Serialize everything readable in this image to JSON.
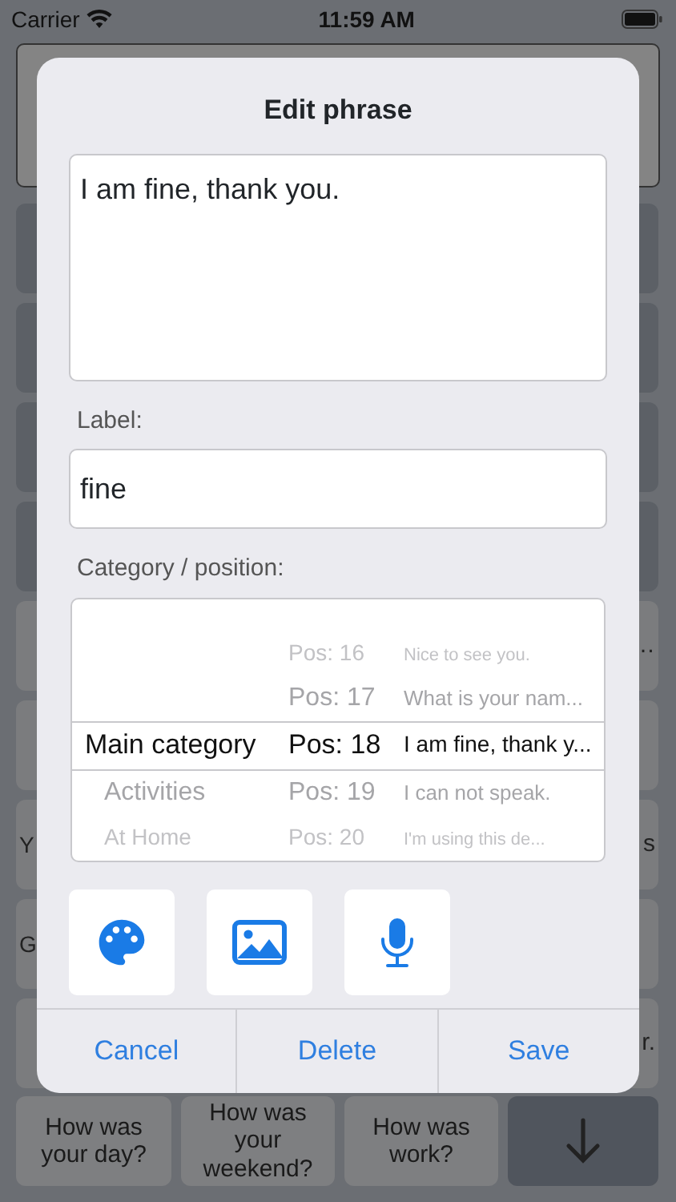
{
  "status_bar": {
    "carrier": "Carrier",
    "time": "11:59 AM"
  },
  "tile_rows": [
    {
      "dark": true
    },
    {
      "dark": true
    },
    {
      "dark": true
    },
    {
      "dark": true
    },
    {
      "dark": false,
      "right": "…"
    },
    {
      "dark": false
    },
    {
      "dark": false,
      "left": "Y",
      "right": "s"
    },
    {
      "dark": false,
      "left": "G"
    },
    {
      "dark": false,
      "right": "r."
    }
  ],
  "quick_phrases": [
    "How was your day?",
    "How was your weekend?",
    "How was work?"
  ],
  "dialog": {
    "title": "Edit phrase",
    "phrase": "I am fine, thank you.",
    "label_caption": "Label:",
    "label_value": "fine",
    "category_caption": "Category / position:",
    "picker_rows": [
      {
        "position": "Pos: 16",
        "phrase": "Nice to see you.",
        "selected": false
      },
      {
        "position": "Pos: 17",
        "phrase": "What is your nam...",
        "selected": false
      },
      {
        "category": "Main category",
        "position": "Pos: 18",
        "phrase": "I am fine, thank y...",
        "selected": true
      },
      {
        "category": "Activities",
        "position": "Pos: 19",
        "phrase": "I can not speak.",
        "selected": false
      },
      {
        "category": "At Home",
        "position": "Pos: 20",
        "phrase": "I'm using this de...",
        "selected": false
      }
    ],
    "tools": [
      {
        "kind": "palette"
      },
      {
        "kind": "image"
      },
      {
        "kind": "microphone"
      }
    ],
    "buttons": [
      "Cancel",
      "Delete",
      "Save"
    ]
  }
}
